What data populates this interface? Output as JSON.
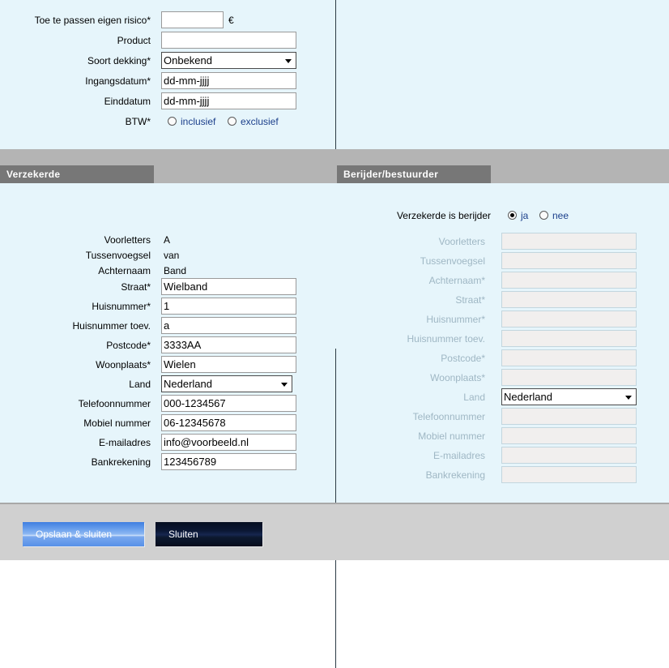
{
  "policy": {
    "rows": [
      {
        "label": "Toe te passen eigen risico*",
        "type": "text",
        "value": "",
        "placeholder": "",
        "suffix": "€"
      },
      {
        "label": "Product",
        "type": "text",
        "value": "",
        "placeholder": ""
      },
      {
        "label": "Soort dekking*",
        "type": "select",
        "value": "Onbekend"
      },
      {
        "label": "Ingangsdatum*",
        "type": "text",
        "value": "dd-mm-jjjj"
      },
      {
        "label": "Einddatum",
        "type": "text",
        "value": "dd-mm-jjjj"
      },
      {
        "label": "BTW*",
        "type": "radio"
      }
    ],
    "btw_options": [
      {
        "label": "inclusief",
        "selected": false
      },
      {
        "label": "exclusief",
        "selected": false
      }
    ]
  },
  "insured": {
    "tab_label": "Verzekerde",
    "rows": [
      {
        "label": "Voorletters",
        "type": "static",
        "value": "A"
      },
      {
        "label": "Tussenvoegsel",
        "type": "static",
        "value": "van"
      },
      {
        "label": "Achternaam",
        "type": "static",
        "value": "Band"
      },
      {
        "label": "Straat*",
        "type": "text",
        "value": "Wielband"
      },
      {
        "label": "Huisnummer*",
        "type": "text",
        "value": "1"
      },
      {
        "label": "Huisnummer toev.",
        "type": "text",
        "value": "a"
      },
      {
        "label": "Postcode*",
        "type": "text",
        "value": "3333AA"
      },
      {
        "label": "Woonplaats*",
        "type": "text",
        "value": "Wielen"
      },
      {
        "label": "Land",
        "type": "select",
        "value": "Nederland"
      },
      {
        "label": "Telefoonnummer",
        "type": "text",
        "value": "000-1234567"
      },
      {
        "label": "Mobiel nummer",
        "type": "text",
        "value": "06-12345678"
      },
      {
        "label": "E-mailadres",
        "type": "text",
        "value": "info@voorbeeld.nl"
      },
      {
        "label": "Bankrekening",
        "type": "text",
        "value": "123456789"
      }
    ]
  },
  "driver": {
    "tab_label": "Berijder/bestuurder",
    "same_as_insured": {
      "label": "Verzekerde is berijder",
      "options": [
        {
          "label": "ja",
          "selected": true
        },
        {
          "label": "nee",
          "selected": false
        }
      ]
    },
    "rows": [
      {
        "label": "Voorletters",
        "type": "text",
        "value": "",
        "disabled": true
      },
      {
        "label": "Tussenvoegsel",
        "type": "text",
        "value": "",
        "disabled": true
      },
      {
        "label": "Achternaam*",
        "type": "text",
        "value": "",
        "disabled": true
      },
      {
        "label": "Straat*",
        "type": "text",
        "value": "",
        "disabled": true
      },
      {
        "label": "Huisnummer*",
        "type": "text",
        "value": "",
        "disabled": true
      },
      {
        "label": "Huisnummer toev.",
        "type": "text",
        "value": "",
        "disabled": true
      },
      {
        "label": "Postcode*",
        "type": "text",
        "value": "",
        "disabled": true
      },
      {
        "label": "Woonplaats*",
        "type": "text",
        "value": "",
        "disabled": true
      },
      {
        "label": "Land",
        "type": "select",
        "value": "Nederland",
        "disabled": false
      },
      {
        "label": "Telefoonnummer",
        "type": "text",
        "value": "",
        "disabled": true
      },
      {
        "label": "Mobiel nummer",
        "type": "text",
        "value": "",
        "disabled": true
      },
      {
        "label": "E-mailadres",
        "type": "text",
        "value": "",
        "disabled": true
      },
      {
        "label": "Bankrekening",
        "type": "text",
        "value": "",
        "disabled": true
      }
    ]
  },
  "footer": {
    "save_label": "Opslaan & sluiten",
    "close_label": "Sluiten"
  },
  "colors": {
    "panel_bg": "#e6f5fb",
    "band_gray": "#b4b4b4",
    "tab_gray": "#777777",
    "footer_gray": "#d0d0d0",
    "link_blue": "#1b3f8b",
    "disabled_text": "#9fb7c4",
    "disabled_field": "#f1efee"
  }
}
